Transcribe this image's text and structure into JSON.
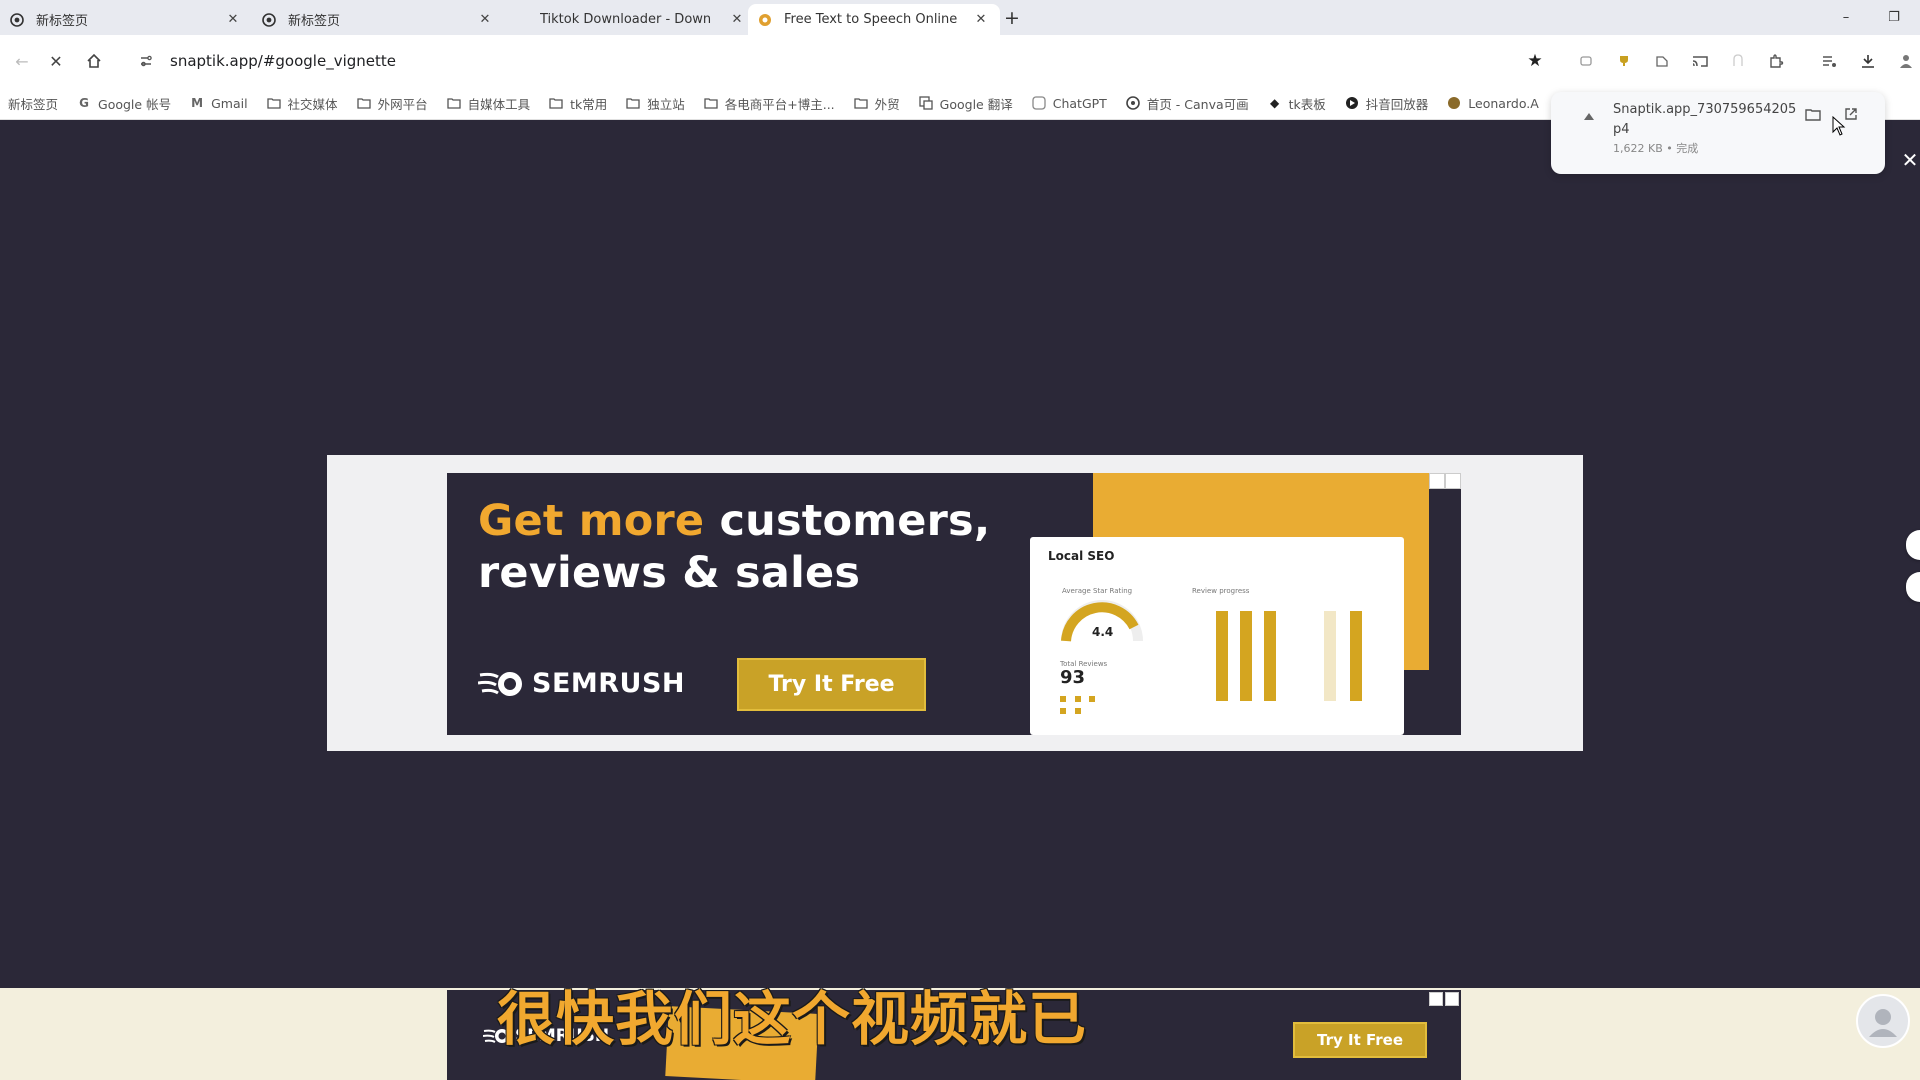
{
  "tabs": [
    {
      "title": "新标签页",
      "favicon": "chrome-icon",
      "active": false
    },
    {
      "title": "新标签页",
      "favicon": "chrome-icon",
      "active": false
    },
    {
      "title": "Tiktok Downloader - Down",
      "favicon": "",
      "active": false
    },
    {
      "title": "Free Text to Speech Online",
      "favicon": "tts-icon",
      "active": true
    }
  ],
  "new_tab_symbol": "+",
  "window_controls": {
    "minimize": "–",
    "restore": "❐"
  },
  "toolbar": {
    "url": "snaptik.app/#google_vignette",
    "back_symbol": "←",
    "stop_symbol": "✕",
    "home_symbol": "⌂",
    "star_symbol": "★"
  },
  "bookmarks": [
    {
      "label": "新标签页",
      "icon": "doc-icon"
    },
    {
      "label": "Google 帐号",
      "icon": "google-icon"
    },
    {
      "label": "Gmail",
      "icon": "gmail-icon"
    },
    {
      "label": "社交媒体",
      "icon": "folder-icon"
    },
    {
      "label": "外网平台",
      "icon": "folder-icon"
    },
    {
      "label": "自媒体工具",
      "icon": "folder-icon"
    },
    {
      "label": "tk常用",
      "icon": "folder-icon"
    },
    {
      "label": "独立站",
      "icon": "folder-icon"
    },
    {
      "label": "各电商平台+博主...",
      "icon": "folder-icon"
    },
    {
      "label": "外贸",
      "icon": "folder-icon"
    },
    {
      "label": "Google 翻译",
      "icon": "translate-icon"
    },
    {
      "label": "ChatGPT",
      "icon": "chatgpt-icon"
    },
    {
      "label": "首页 - Canva可画",
      "icon": "canva-icon"
    },
    {
      "label": "tk表板",
      "icon": "tiktok-icon"
    },
    {
      "label": "抖音回放器",
      "icon": "record-icon"
    },
    {
      "label": "Leonardo.A",
      "icon": "leonardo-icon"
    }
  ],
  "download": {
    "filename": "Snaptik.app_7307596542055...p4",
    "filename_line1": "Snaptik.app_730759654205",
    "filename_line2": "p4",
    "size": "1,622 KB • 完成"
  },
  "ad": {
    "headline_highlight": "Get more",
    "headline_rest": " customers,",
    "headline_line2": "reviews & sales",
    "brand": "SEMRUSH",
    "cta": "Try It Free",
    "card": {
      "title": "Local SEO",
      "avg_label": "Average Star Rating",
      "avg_value": "4.4",
      "reviews_label": "Total Reviews",
      "reviews_value": "93",
      "progress_label": "Review progress"
    },
    "colors": {
      "accent": "#f1a82f",
      "cta": "#c9a227",
      "background": "#2b2838"
    }
  },
  "bottom_ad": {
    "brand": "SEMRUSH",
    "cta": "Try It Free"
  },
  "subtitle": "很快我们这个视频就已"
}
